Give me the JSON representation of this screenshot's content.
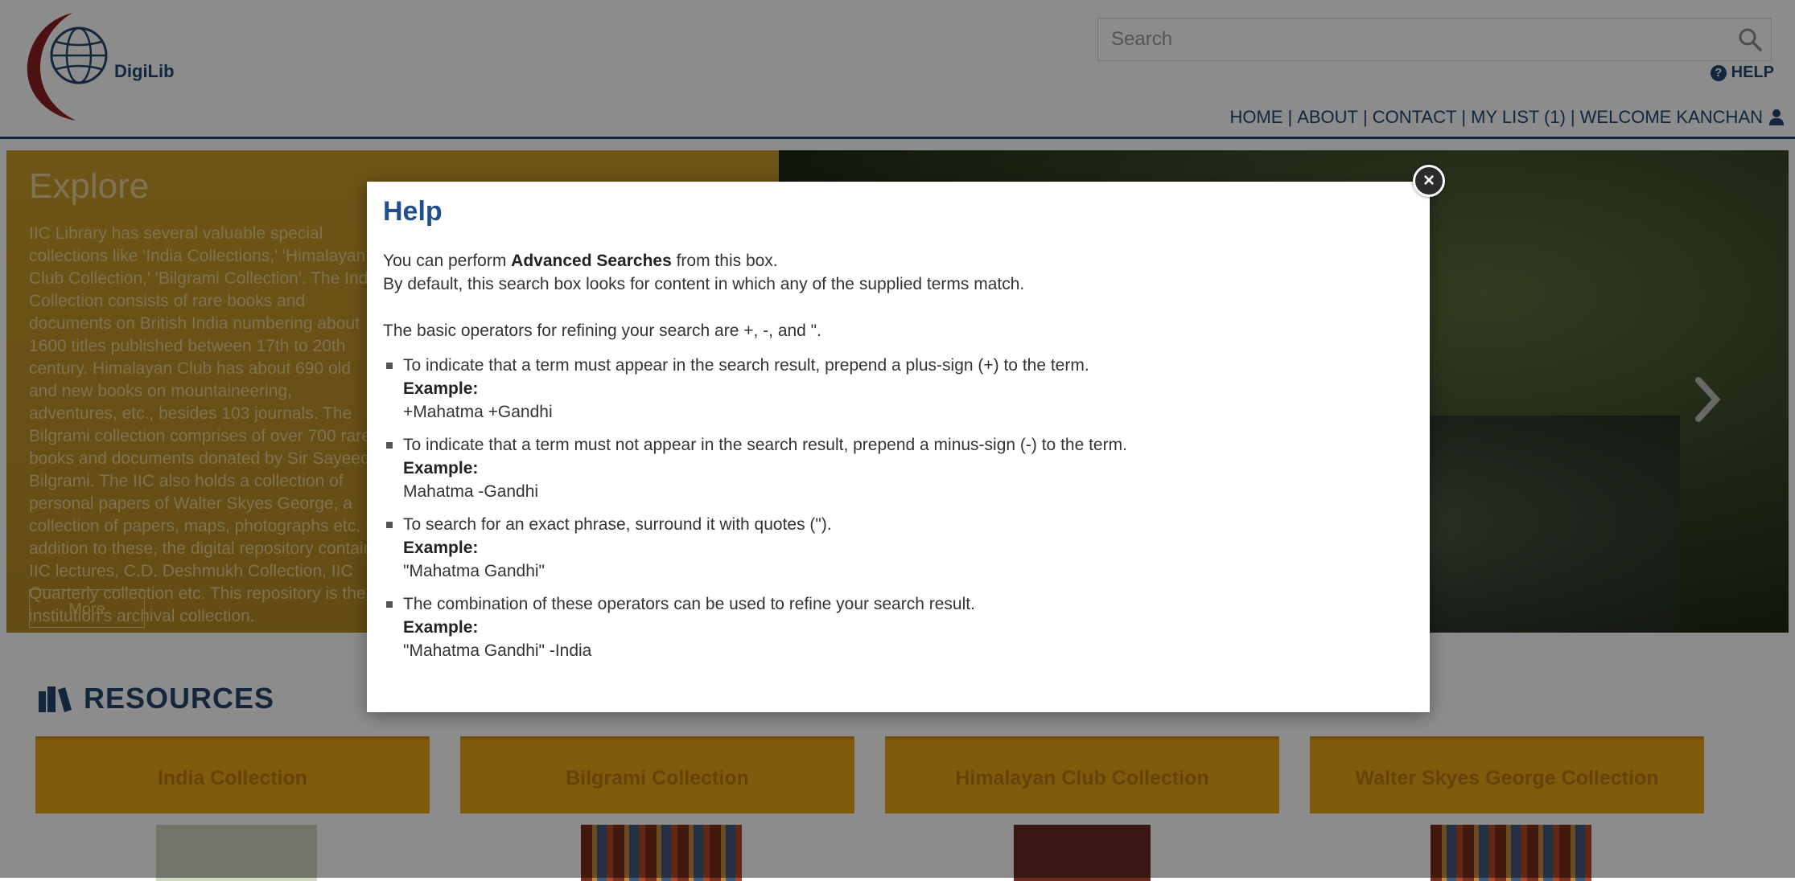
{
  "header": {
    "logo_text": "DigiLib",
    "search_placeholder": "Search",
    "help_label": "HELP",
    "nav": [
      {
        "label": "HOME"
      },
      {
        "label": "ABOUT"
      },
      {
        "label": "CONTACT"
      },
      {
        "label": "MY LIST (1)"
      },
      {
        "label": "WELCOME KANCHAN"
      }
    ]
  },
  "hero": {
    "title": "Explore",
    "text": "IIC Library has several valuable special collections like 'India Collections,' 'Himalayan Club Collection,' 'Bilgrami Collection'. The India Collection consists of rare books and documents on British India numbering about 1600 titles published between 17th to 20th century. Himalayan Club has about 690 old and new books on mountaineering, adventures, etc., besides 103 journals. The Bilgrami collection comprises of over 700 rare books and documents donated by Sir Sayeed Bilgrami. The IIC also holds a collection of personal papers of Walter Skyes George, a collection of papers, maps, photographs etc. In addition to these, the digital repository contains IIC lectures, C.D. Deshmukh Collection, IIC Quarterly collection etc. This repository is the institution's archival collection.",
    "more_label": "More"
  },
  "resources": {
    "title": "RESOURCES",
    "cards": [
      {
        "title": "India Collection"
      },
      {
        "title": "Bilgrami Collection"
      },
      {
        "title": "Himalayan Club Collection"
      },
      {
        "title": "Walter Skyes George Collection"
      }
    ]
  },
  "modal": {
    "close_label": "×",
    "title": "Help",
    "intro_prefix": "You can perform ",
    "intro_bold": "Advanced Searches",
    "intro_suffix": " from this box.",
    "intro_line2": "By default, this search box looks for content in which any of the supplied terms match.",
    "operators_line": "The basic operators for refining your search are +, -, and \".",
    "items": [
      {
        "text": "To indicate that a term must appear in the search result, prepend a plus-sign (+) to the term.",
        "example_label": "Example:",
        "example": "+Mahatma +Gandhi"
      },
      {
        "text": "To indicate that a term must not appear in the search result, prepend a minus-sign (-) to the term.",
        "example_label": "Example:",
        "example": "Mahatma -Gandhi"
      },
      {
        "text": "To search for an exact phrase, surround it with quotes (\").",
        "example_label": "Example:",
        "example": "\"Mahatma Gandhi\""
      },
      {
        "text": "The combination of these operators can be used to refine your search result.",
        "example_label": "Example:",
        "example": "\"Mahatma Gandhi\" -India"
      }
    ]
  },
  "colors": {
    "brand": "#23466e",
    "accent": "#e9a71b",
    "modal_title": "#1f4f8c"
  }
}
